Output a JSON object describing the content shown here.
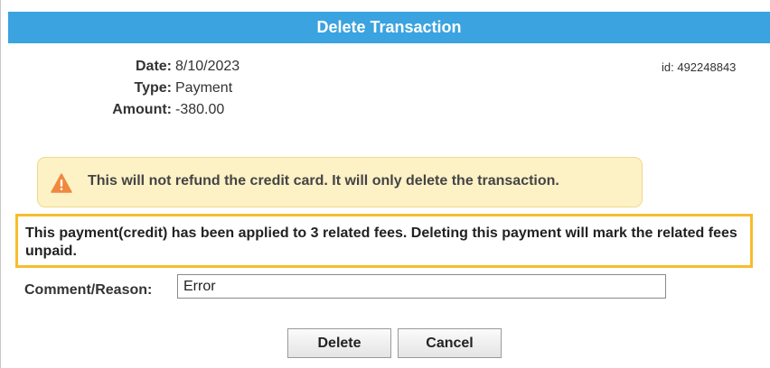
{
  "dialog": {
    "title": "Delete Transaction",
    "id_label": "id: 492248843"
  },
  "details": {
    "date_label": "Date:",
    "date_value": "8/10/2023",
    "type_label": "Type:",
    "type_value": "Payment",
    "amount_label": "Amount:",
    "amount_value": "-380.00"
  },
  "warning": {
    "icon": "warning-triangle-icon",
    "message": "This will not refund the credit card. It will only delete the transaction.",
    "color": "#fdf1c6",
    "icon_color": "#f0883e"
  },
  "notice": {
    "message": "This payment(credit) has been applied to 3 related fees. Deleting this payment will mark the related fees unpaid.",
    "highlight_color": "#f6bd2c"
  },
  "comment": {
    "label": "Comment/Reason:",
    "value": "Error"
  },
  "buttons": {
    "delete_label": "Delete",
    "cancel_label": "Cancel"
  },
  "colors": {
    "title_bar": "#3aa3e0"
  }
}
